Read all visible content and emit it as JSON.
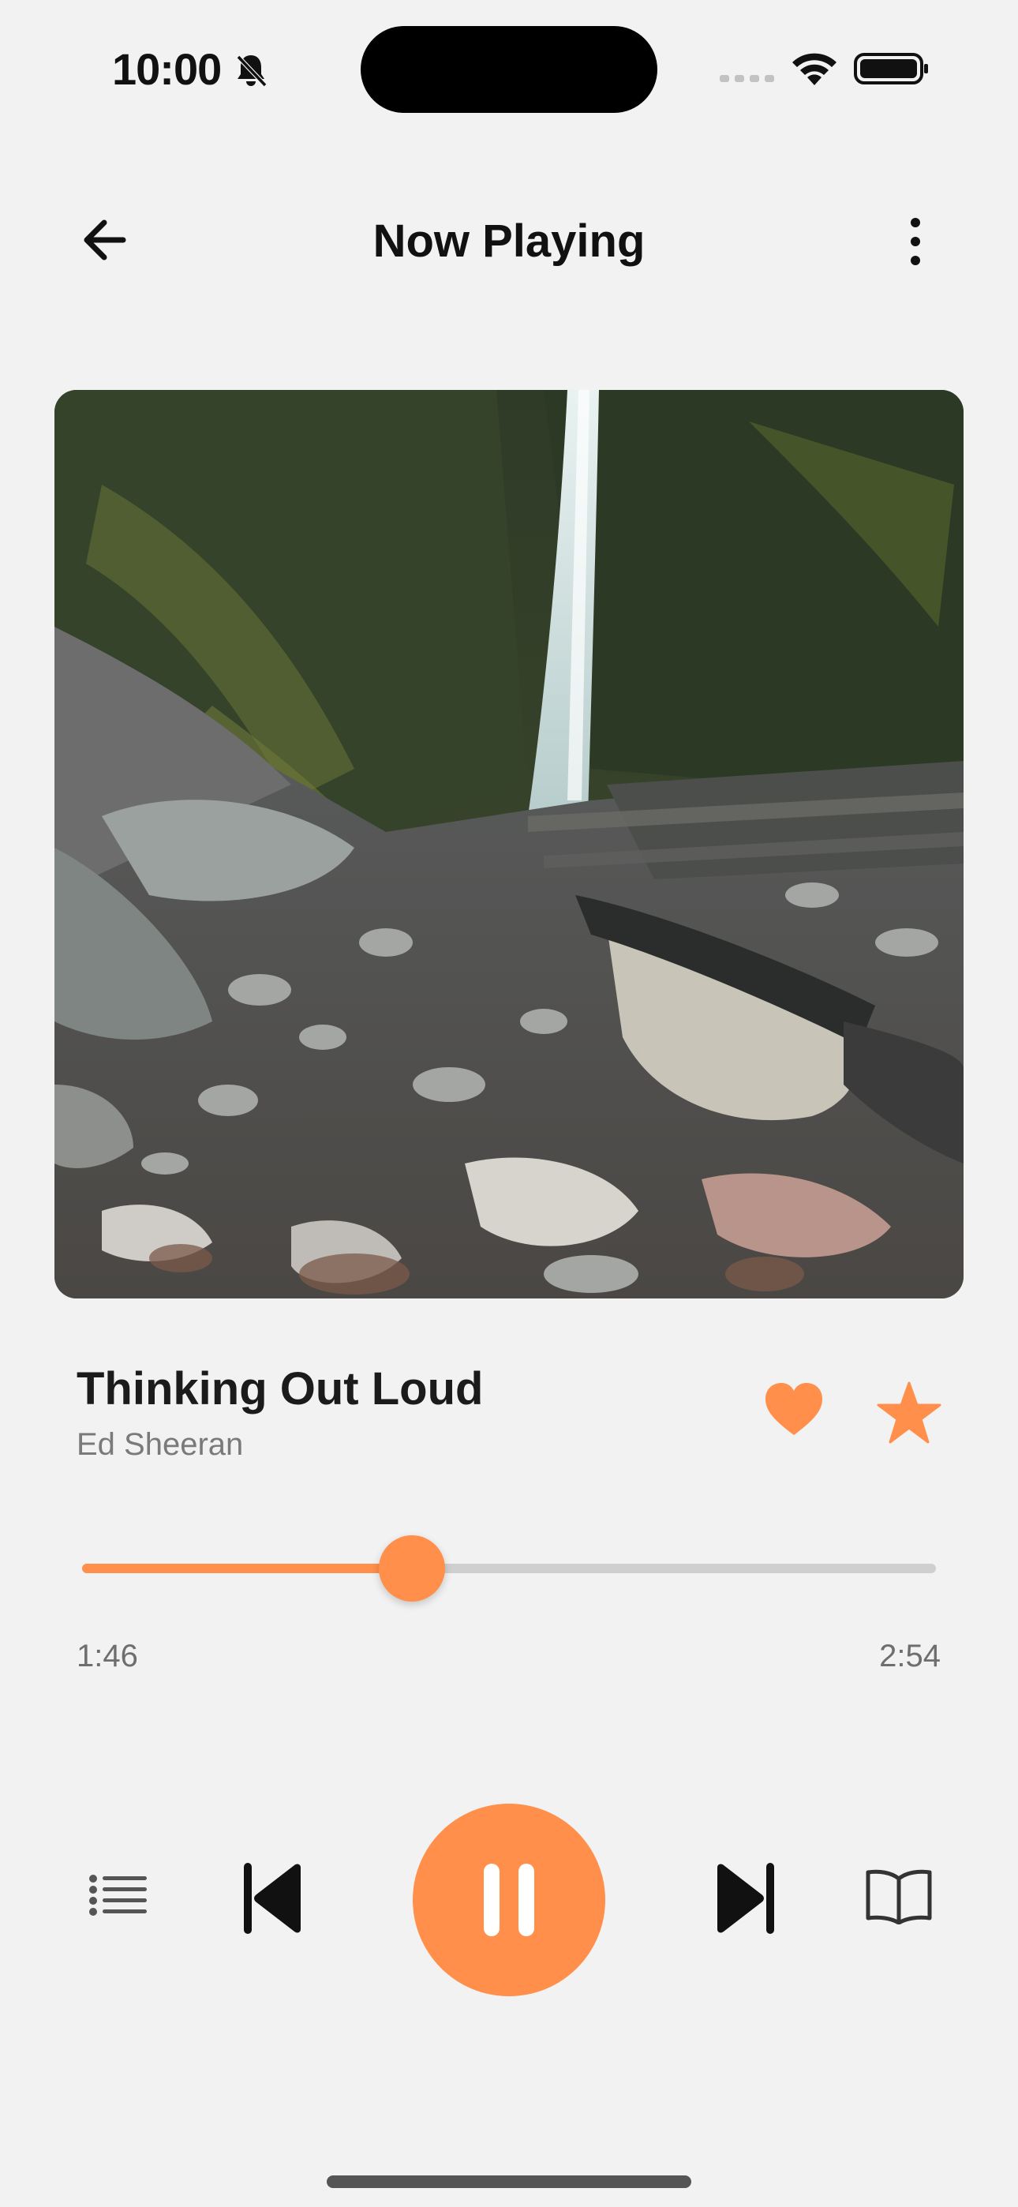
{
  "status_bar": {
    "time": "10:00",
    "icons": [
      "bell-slash-icon",
      "signal-icon",
      "wifi-icon",
      "battery-icon"
    ]
  },
  "header": {
    "title": "Now Playing",
    "back_icon": "arrow-left-icon",
    "menu_icon": "more-vertical-icon"
  },
  "artwork": {
    "subject": "waterfall-over-rocks-photo"
  },
  "track": {
    "title": "Thinking Out Loud",
    "artist": "Ed Sheeran",
    "liked": true,
    "starred": true
  },
  "playback": {
    "elapsed": "1:46",
    "total": "2:54",
    "progress_fraction": 0.386,
    "state": "playing"
  },
  "controls": [
    "queue-icon",
    "skip-previous-icon",
    "pause-icon",
    "skip-next-icon",
    "book-icon"
  ],
  "colors": {
    "accent": "#ff8f4a",
    "background": "#f2f2f2",
    "track_inactive": "#cfcfcf",
    "text_primary": "#1b1b1b",
    "text_secondary": "#7a7a7a"
  }
}
